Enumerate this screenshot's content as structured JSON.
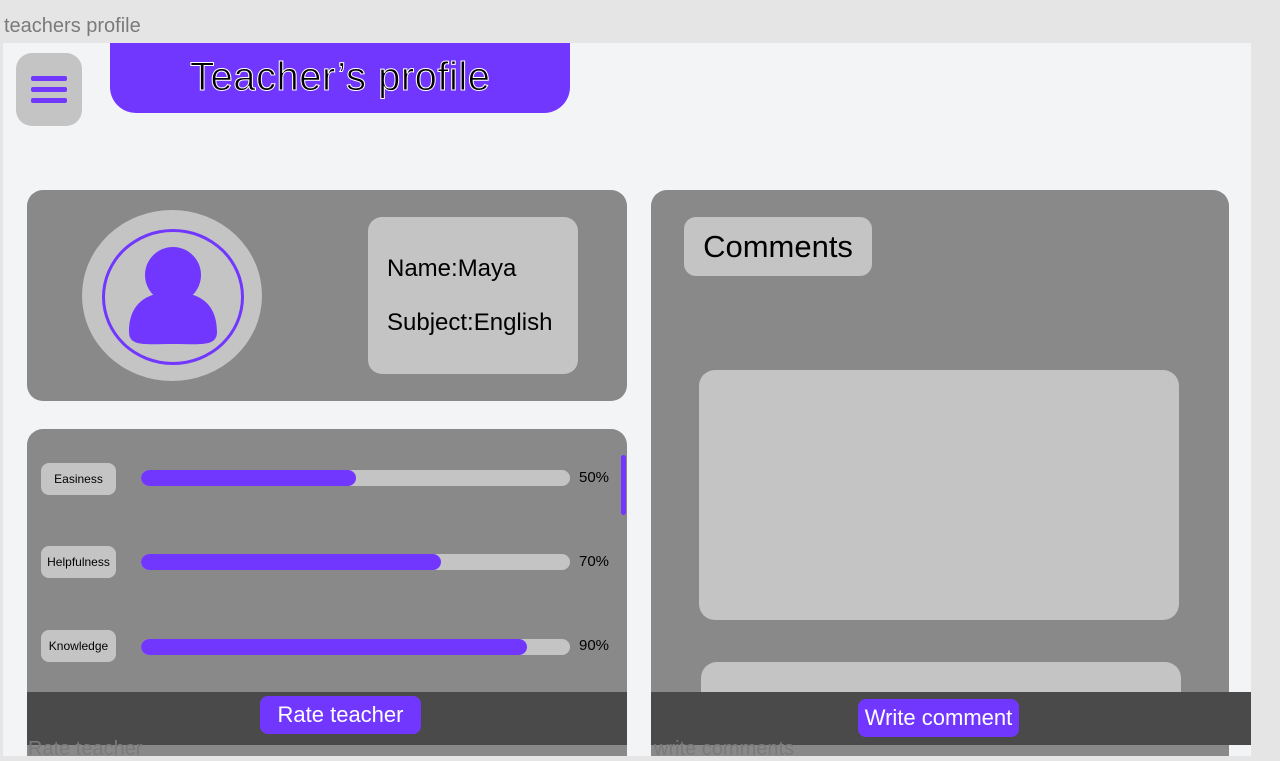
{
  "frame": {
    "label": "teachers profile"
  },
  "header": {
    "title": "Teacher’s profile",
    "menu_icon": "hamburger-icon"
  },
  "profile": {
    "avatar_icon": "user-icon",
    "name_line": "Name:Maya",
    "subject_line": "Subject:English"
  },
  "ratings": {
    "items": [
      {
        "label": "Easiness",
        "percent_text": "50%",
        "value": 0.5
      },
      {
        "label": "Helpfulness",
        "percent_text": "70%",
        "value": 0.7
      },
      {
        "label": "Knowledge",
        "percent_text": "90%",
        "value": 0.9
      }
    ],
    "rate_button": "Rate teacher"
  },
  "comments": {
    "heading": "Comments",
    "write_button": "Write comment"
  },
  "bottom_labels": {
    "left": "Rate teacher",
    "right": "write comments"
  },
  "colors": {
    "accent": "#7137ff",
    "card": "#898989",
    "chip": "#c4c4c4",
    "bar": "#4a4a4a"
  }
}
